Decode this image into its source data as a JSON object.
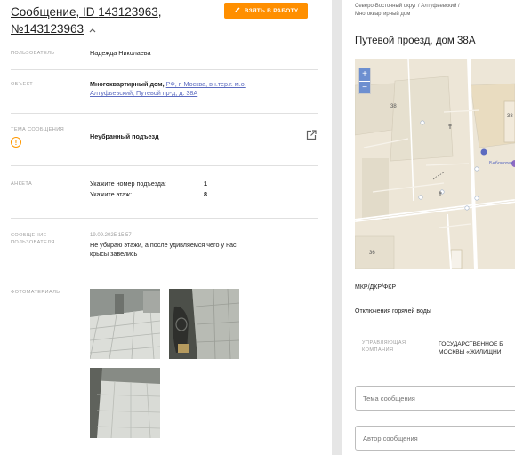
{
  "message": {
    "title_prefix": "Сообщение, ID ",
    "title_id": "143123963",
    "title_comma": ",",
    "title_number": "№143123963",
    "chevron": "^",
    "take_button": "ВЗЯТЬ В РАБОТУ"
  },
  "fields": {
    "user_label": "ПОЛЬЗОВАТЕЛЬ",
    "user_value": "Надежда Николаева",
    "object_label": "ОБЪЕКТ",
    "object_type": "Многоквартирный дом, ",
    "object_address_line1": "РФ, г. Москва, вн.тер.г. м.о.",
    "object_address_line2": "Алтуфьевский, Путевой пр-д, д. 38А",
    "topic_label": "ТЕМА СООБЩЕНИЯ",
    "topic_value": "Неубранный подъезд",
    "form_label": "АНКЕТА",
    "form_q1": "Укажите номер подъезда:",
    "form_a1": "1",
    "form_q2": "Укажите этаж:",
    "form_a2": "8",
    "msg_label_line1": "СООБЩЕНИЕ",
    "msg_label_line2": "ПОЛЬЗОВАТЕЛЯ",
    "msg_date": "19.09.2025 15:57",
    "msg_text_line1": "Не убираю этажи, а после удивляемся чего у нас",
    "msg_text_line2": "крысы завелись",
    "photos_label": "ФОТОМАТЕРИАЛЫ"
  },
  "right": {
    "breadcrumb_line1": "Северо-Восточный округ / Алтуфьевский /",
    "breadcrumb_line2": "Многоквартирный дом",
    "title": "Путевой проезд, дом 38А",
    "map": {
      "zoom_in": "+",
      "zoom_out": "−",
      "label_38_left": "38",
      "label_38_right": "38",
      "label_36": "36",
      "label_library": "Библиотек"
    },
    "section_mkd": "МКР/ДКР/ФКР",
    "section_hot_water": "Отключения горячей воды",
    "company_label_line1": "УПРАВЛЯЮЩАЯ",
    "company_label_line2": "КОМПАНИЯ",
    "company_value_line1": "ГОСУДАРСТВЕННОЕ Б",
    "company_value_line2": "МОСКВЫ «ЖИЛИЩНИ",
    "topic_input_placeholder": "Тема сообщения",
    "author_input_placeholder": "Автор сообщения"
  },
  "colors": {
    "accent_orange": "#ff8f00",
    "link_blue": "#5c6bc0"
  }
}
